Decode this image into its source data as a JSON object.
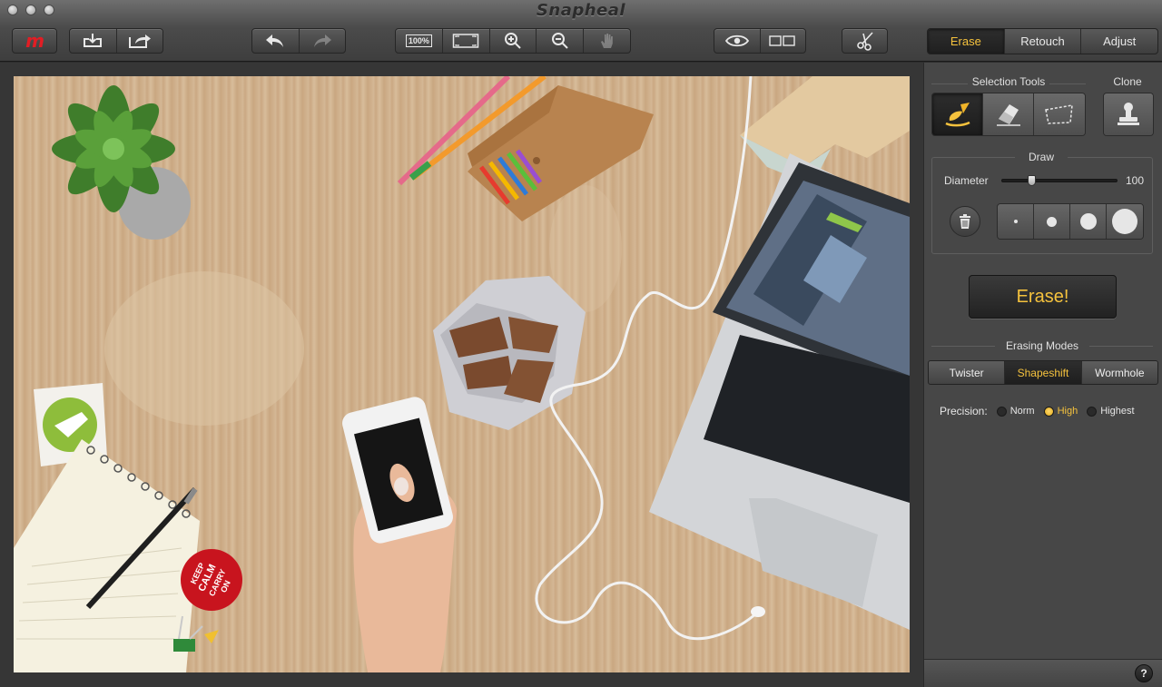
{
  "app": {
    "title": "Snapheal"
  },
  "mode_tabs": [
    {
      "label": "Erase",
      "active": true
    },
    {
      "label": "Retouch",
      "active": false
    },
    {
      "label": "Adjust",
      "active": false
    }
  ],
  "zoom": {
    "actual_size_label": "100%"
  },
  "panel": {
    "selection_tools_label": "Selection Tools",
    "clone_label": "Clone",
    "draw_label": "Draw",
    "diameter_label": "Diameter",
    "diameter_value": "100",
    "diameter_fraction": 0.26,
    "erase_button": "Erase!",
    "erasing_modes_label": "Erasing Modes",
    "erasing_modes": [
      {
        "label": "Twister",
        "active": false
      },
      {
        "label": "Shapeshift",
        "active": true
      },
      {
        "label": "Wormhole",
        "active": false
      }
    ],
    "precision_label": "Precision:",
    "precision_options": [
      {
        "label": "Norm",
        "selected": false
      },
      {
        "label": "High",
        "selected": true
      },
      {
        "label": "Highest",
        "selected": false
      }
    ],
    "help_label": "?"
  },
  "photo": {
    "button_text_1": "KEEP",
    "button_text_2": "CALM",
    "button_text_3": "CARRY",
    "button_text_4": "ON"
  },
  "colors": {
    "accent": "#f5c23d",
    "logo": "#e21d24"
  }
}
